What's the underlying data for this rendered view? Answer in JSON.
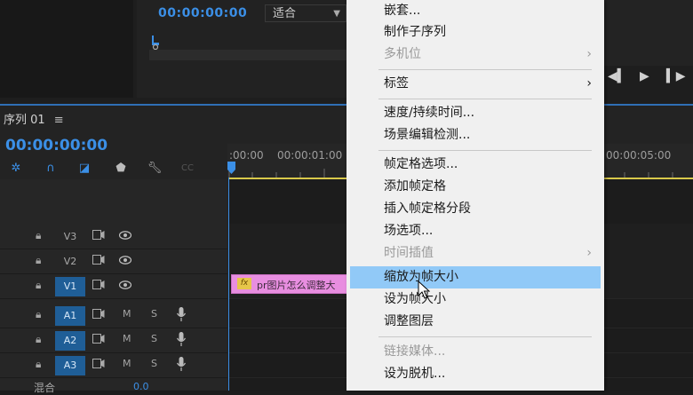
{
  "program_monitor": {
    "timecode": "00:00:00:00",
    "fit_label": "适合"
  },
  "sequence": {
    "tab_title": "序列 01",
    "timecode": "00:00:00:00",
    "ruler_labels": [
      ":00:00",
      "00:00:01:00",
      "00:00:05:00"
    ],
    "video_tracks": [
      "V3",
      "V2",
      "V1"
    ],
    "audio_tracks": [
      "A1",
      "A2",
      "A3"
    ],
    "audio_m": "M",
    "audio_s": "S",
    "master_label": "混合",
    "master_value": "0.0",
    "clip_label": "pr图片怎么调整大"
  },
  "context_menu": {
    "items": [
      {
        "label": "嵌套...",
        "enabled": true
      },
      {
        "label": "制作子序列",
        "enabled": true
      },
      {
        "label": "多机位",
        "enabled": false,
        "submenu": true
      },
      {
        "label": "标签",
        "enabled": true,
        "submenu": true
      },
      {
        "label": "速度/持续时间...",
        "enabled": true
      },
      {
        "label": "场景编辑检测...",
        "enabled": true
      },
      {
        "label": "帧定格选项...",
        "enabled": true
      },
      {
        "label": "添加帧定格",
        "enabled": true
      },
      {
        "label": "插入帧定格分段",
        "enabled": true
      },
      {
        "label": "场选项...",
        "enabled": true
      },
      {
        "label": "时间插值",
        "enabled": false,
        "submenu": true
      },
      {
        "label": "缩放为帧大小",
        "enabled": true,
        "highlighted": true
      },
      {
        "label": "设为帧大小",
        "enabled": true
      },
      {
        "label": "调整图层",
        "enabled": true
      },
      {
        "label": "链接媒体...",
        "enabled": false
      },
      {
        "label": "设为脱机...",
        "enabled": true
      }
    ]
  },
  "colors": {
    "accent_blue": "#3b8fe6",
    "clip_pink": "#e88ee0",
    "menu_highlight": "#91c9f7",
    "work_area_yellow": "#d8c84a"
  }
}
